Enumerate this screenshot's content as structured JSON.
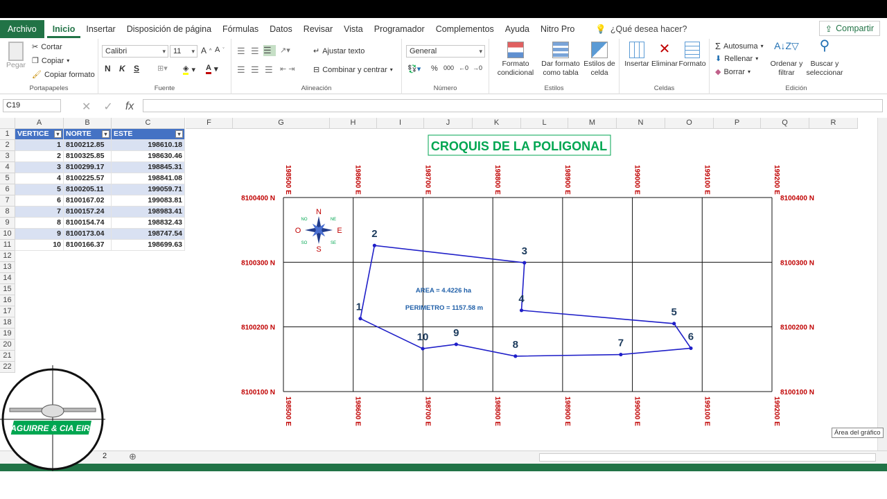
{
  "ribbon_tabs": {
    "file": "Archivo",
    "home": "Inicio",
    "insert": "Insertar",
    "layout": "Disposición de página",
    "formulas": "Fórmulas",
    "data": "Datos",
    "review": "Revisar",
    "view": "Vista",
    "developer": "Programador",
    "addins": "Complementos",
    "help": "Ayuda",
    "nitro": "Nitro Pro",
    "tellme": "¿Qué desea hacer?",
    "share": "Compartir"
  },
  "clipboard": {
    "paste": "Pegar",
    "cut": "Cortar",
    "copy": "Copiar",
    "format_painter": "Copiar formato",
    "label": "Portapapeles"
  },
  "font": {
    "name": "Calibri",
    "size": "11",
    "bold": "N",
    "italic": "K",
    "underline": "S",
    "label": "Fuente"
  },
  "alignment": {
    "wrap": "Ajustar texto",
    "merge": "Combinar y centrar",
    "label": "Alineación"
  },
  "number": {
    "format": "General",
    "label": "Número"
  },
  "styles": {
    "cond_format": "Formato condicional",
    "format_table": "Dar formato como tabla",
    "cell_styles": "Estilos de celda",
    "label": "Estilos"
  },
  "cells": {
    "insert": "Insertar",
    "delete": "Eliminar",
    "format": "Formato",
    "label": "Celdas"
  },
  "editing": {
    "autosum": "Autosuma",
    "fill": "Rellenar",
    "clear": "Borrar",
    "sort": "Ordenar y filtrar",
    "find": "Buscar y seleccionar",
    "label": "Edición"
  },
  "formula_bar": {
    "name_box": "C19",
    "fx": "fx"
  },
  "columns": [
    "A",
    "B",
    "C",
    "F",
    "G",
    "H",
    "I",
    "J",
    "K",
    "L",
    "M",
    "N",
    "O",
    "P",
    "Q",
    "R"
  ],
  "rows": [
    "1",
    "2",
    "3",
    "4",
    "5",
    "6",
    "7",
    "8",
    "9",
    "10",
    "11",
    "12",
    "13",
    "14",
    "15",
    "16",
    "17",
    "18",
    "19",
    "20",
    "21",
    "22"
  ],
  "table": {
    "headers": [
      "VERTICE",
      "NORTE",
      "ESTE"
    ],
    "rows": [
      [
        "1",
        "8100212.85",
        "198610.18"
      ],
      [
        "2",
        "8100325.85",
        "198630.46"
      ],
      [
        "3",
        "8100299.17",
        "198845.31"
      ],
      [
        "4",
        "8100225.57",
        "198841.08"
      ],
      [
        "5",
        "8100205.11",
        "199059.71"
      ],
      [
        "6",
        "8100167.02",
        "199083.81"
      ],
      [
        "7",
        "8100157.24",
        "198983.41"
      ],
      [
        "8",
        "8100154.74",
        "198832.43"
      ],
      [
        "9",
        "8100173.04",
        "198747.54"
      ],
      [
        "10",
        "8100166.37",
        "198699.63"
      ]
    ]
  },
  "chart_data": {
    "type": "scatter",
    "title": "CROQUIS DE LA POLIGONAL",
    "x_ticks": [
      "198500 E",
      "198600 E",
      "198700 E",
      "198800 E",
      "198900 E",
      "199000 E",
      "199100 E",
      "199200 E"
    ],
    "y_ticks": [
      "8100400 N",
      "8100300 N",
      "8100200 N",
      "8100100 N"
    ],
    "xlim": [
      198500,
      199200
    ],
    "ylim": [
      8100100,
      8100400
    ],
    "grid": true,
    "points": [
      {
        "label": "1",
        "x": 198610.18,
        "y": 8100212.85
      },
      {
        "label": "2",
        "x": 198630.46,
        "y": 8100325.85
      },
      {
        "label": "3",
        "x": 198845.31,
        "y": 8100299.17
      },
      {
        "label": "4",
        "x": 198841.08,
        "y": 8100225.57
      },
      {
        "label": "5",
        "x": 199059.71,
        "y": 8100205.11
      },
      {
        "label": "6",
        "x": 199083.81,
        "y": 8100167.02
      },
      {
        "label": "7",
        "x": 198983.41,
        "y": 8100157.24
      },
      {
        "label": "8",
        "x": 198832.43,
        "y": 8100154.74
      },
      {
        "label": "9",
        "x": 198747.54,
        "y": 8100173.04
      },
      {
        "label": "10",
        "x": 198699.63,
        "y": 8100166.37
      }
    ],
    "annotations": [
      "AREA = 4.4226 ha",
      "PERIMETRO = 1157.58 m"
    ],
    "compass": {
      "n": "N",
      "s": "S",
      "e": "E",
      "w": "O",
      "ne": "NE",
      "nw": "NO",
      "se": "SE",
      "sw": "SO"
    },
    "colors": {
      "polygon": "#1f1fc8",
      "labels": "#1b3a5c",
      "ticks": "#c00000",
      "title": "#00a651",
      "annotation": "#1f5fa8"
    }
  },
  "tooltip": "Área del gráfico",
  "sheet_tab": "2",
  "logo_text": "AGUIRRE & CIA EIRL"
}
